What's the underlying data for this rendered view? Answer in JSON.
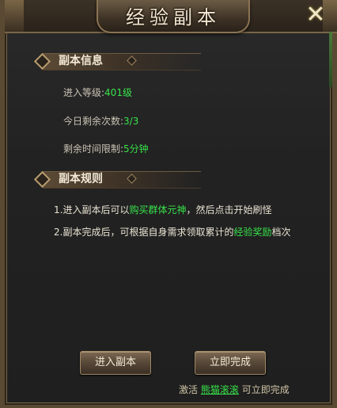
{
  "window": {
    "title": "经验副本",
    "close_icon": "close-icon"
  },
  "info_section": {
    "title": "副本信息",
    "rows": [
      {
        "label": "进入等级:",
        "value": "401级"
      },
      {
        "label": "今日剩余次数:",
        "value": "3/3"
      },
      {
        "label": "剩余时间限制:",
        "value": "5分钟"
      }
    ]
  },
  "rules_section": {
    "title": "副本规则",
    "rule1": {
      "before": "1.进入副本后可以",
      "highlight": "购买群体元神",
      "after": "，然后点击开始刷怪"
    },
    "rule2": {
      "before": "2.副本完成后，可根据自身需求领取累计的",
      "highlight": "经验奖励",
      "after": "档次"
    }
  },
  "buttons": {
    "enter": "进入副本",
    "complete": "立即完成"
  },
  "footer": {
    "prefix": "激活",
    "link": "熊猫滚滚",
    "suffix": "可立即完成"
  },
  "colors": {
    "highlight_green": "#38e24a",
    "frame_brown": "#5a4a33"
  }
}
